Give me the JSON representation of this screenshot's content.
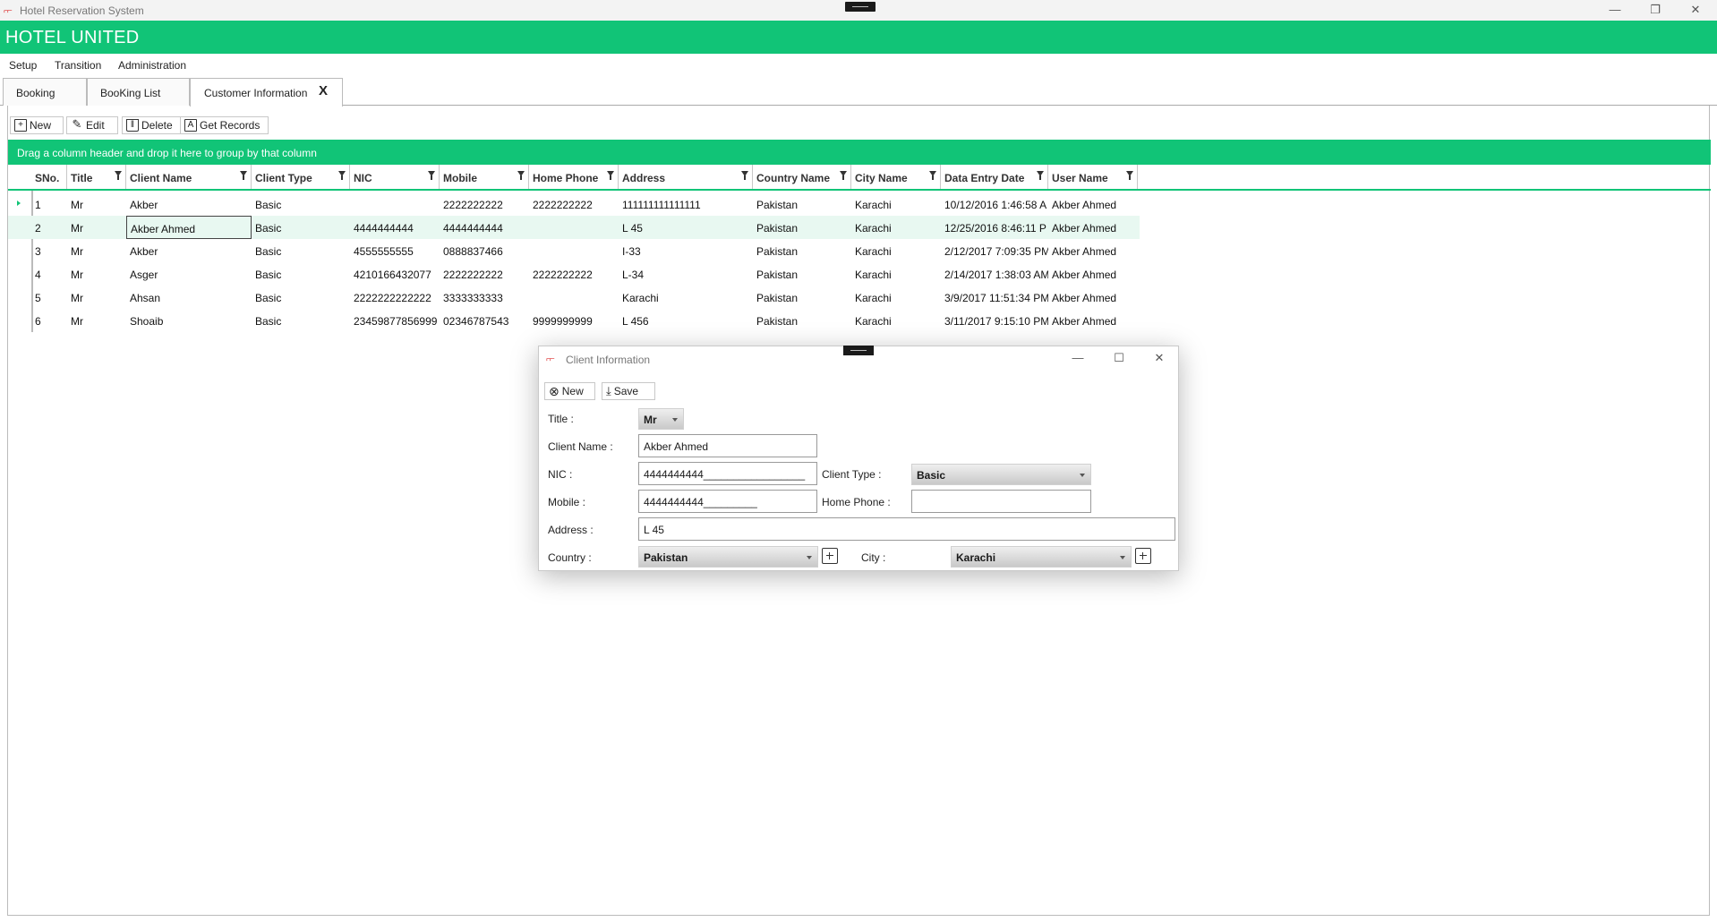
{
  "window": {
    "title": "Hotel Reservation System",
    "minimize": "—",
    "restore": "❐",
    "close": "✕"
  },
  "brand": "HOTEL UNITED",
  "menu": [
    "Setup",
    "Transition",
    "Administration"
  ],
  "tabs": [
    {
      "label": "Booking"
    },
    {
      "label": "BooKing List"
    },
    {
      "label": "Customer Information",
      "close": "X"
    }
  ],
  "toolbar": {
    "new_label": "New",
    "edit_label": "Edit",
    "delete_label": "Delete",
    "get_records_label": "Get Records"
  },
  "group_panel": "Drag a column header and drop it here to group by that column",
  "columns": [
    "SNo.",
    "Title",
    "Client Name",
    "Client Type",
    "NIC",
    "Mobile",
    "Home Phone",
    "Address",
    "Country Name",
    "City Name",
    "Data Entry Date",
    "User Name"
  ],
  "rows": [
    [
      "1",
      "Mr",
      "Akber",
      "Basic",
      "",
      "2222222222",
      "2222222222",
      "111111111111111",
      "Pakistan",
      "Karachi",
      "10/12/2016 1:46:58 A",
      "Akber Ahmed"
    ],
    [
      "2",
      "Mr",
      "Akber Ahmed",
      "Basic",
      "4444444444",
      "4444444444",
      "",
      "L 45",
      "Pakistan",
      "Karachi",
      "12/25/2016 8:46:11 P",
      "Akber Ahmed"
    ],
    [
      "3",
      "Mr",
      "Akber",
      "Basic",
      "4555555555",
      "0888837466",
      "",
      "I-33",
      "Pakistan",
      "Karachi",
      "2/12/2017 7:09:35 PM",
      "Akber Ahmed"
    ],
    [
      "4",
      "Mr",
      "Asger",
      "Basic",
      "4210166432077",
      "2222222222",
      "2222222222",
      "L-34",
      "Pakistan",
      "Karachi",
      "2/14/2017 1:38:03 AM",
      "Akber Ahmed"
    ],
    [
      "5",
      "Mr",
      "Ahsan",
      "Basic",
      "2222222222222",
      "3333333333",
      "",
      "Karachi",
      "Pakistan",
      "Karachi",
      "3/9/2017 11:51:34 PM",
      "Akber Ahmed"
    ],
    [
      "6",
      "Mr",
      "Shoaib",
      "Basic",
      "23459877856999",
      "02346787543",
      "9999999999",
      "L 456",
      "Pakistan",
      "Karachi",
      "3/11/2017 9:15:10 PM",
      "Akber Ahmed"
    ]
  ],
  "dialog": {
    "title": "Client Information",
    "new_label": "New",
    "save_label": "Save",
    "labels": {
      "title": "Title :",
      "client_name": "Client Name :",
      "nic": "NIC :",
      "client_type": "Client Type :",
      "mobile": "Mobile :",
      "home_phone": "Home Phone :",
      "address": "Address :",
      "country": "Country :",
      "city": "City :"
    },
    "values": {
      "title": "Mr",
      "client_name": "Akber Ahmed",
      "nic": "4444444444_________________",
      "client_type": "Basic",
      "mobile": "4444444444_________",
      "home_phone": "",
      "address": "L 45",
      "country": "Pakistan",
      "city": "Karachi"
    }
  },
  "colors": {
    "accent": "#11c477",
    "row_alt": "#e8f8f1"
  }
}
